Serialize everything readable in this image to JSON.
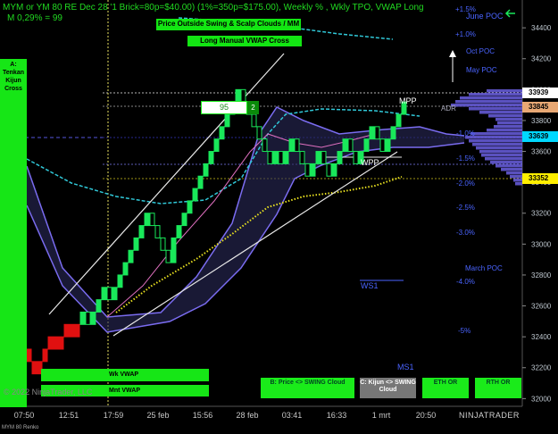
{
  "header": {
    "title": "MYM or YM 80 RE Dec 28 '1 Brick=80p=$40.00) (1%=350p=$175.00), Weekly % , Wkly TPO, VWAP Long",
    "subtitle": "M 0,29% = 99"
  },
  "banners": {
    "outside_swing": "Price Outside Swing & Scalp Clouds / MM ???",
    "long_vwap": "Long Manual VWAP Cross",
    "tenkan": "A: Tenkan Kijun Cross",
    "box_value": "95",
    "box_small": "2"
  },
  "buttons": {
    "wk_vwap": "Wk VWAP",
    "mnt_vwap": "Mnt VWAP",
    "price_swing": "B: Price <> SWING Cloud",
    "kijun_swing": "C: Kijun <> SWING Cloud",
    "eth_or": "ETH OR",
    "rth_or": "RTH OR"
  },
  "right_labels": {
    "june_poc": "June POC",
    "oct_poc": "Oct POC",
    "may_poc": "May POC",
    "march_poc": "March POC",
    "mpp": "MPP",
    "adr": "ADR",
    "wpp": "WPP",
    "ws1": "WS1",
    "ms1": "MS1"
  },
  "pct_labels": [
    "+1.5%",
    "+1.0%",
    "-1.0%",
    "-1.5%",
    "-2.0%",
    "-2.5%",
    "-3.0%",
    "-4.0%",
    "-5%"
  ],
  "price_tags": {
    "t1": "33939",
    "t2": "33845",
    "t3": "33639",
    "t4": "33352"
  },
  "colors": {
    "up_brick": "#19e85a",
    "down_brick": "#e01010",
    "cloud": "#6a5fe0",
    "accent_green": "#16e616"
  },
  "footer": {
    "copyright": "© 2022 NinjaTrader, LLC",
    "instrument": "MYM 80 Renko",
    "brand": "NINJATRADER"
  },
  "chart_data": {
    "type": "renko",
    "y_axis_ticks": [
      34400,
      34200,
      34000,
      33800,
      33600,
      33400,
      33200,
      33000,
      32800,
      32600,
      32400,
      32200,
      32000
    ],
    "x_axis_ticks": [
      "07:50",
      "12:51",
      "17:59",
      "25 feb",
      "15:56",
      "28 feb",
      "03:41",
      "16:33",
      "1 mrt",
      "20:50"
    ],
    "ylim": [
      31950,
      34580
    ],
    "brick_size": 80,
    "closes": [
      32400,
      32320,
      32240,
      32320,
      32240,
      32160,
      32240,
      32320,
      32400,
      32320,
      32400,
      32480,
      32400,
      32480,
      32560,
      32480,
      32560,
      32640,
      32720,
      32640,
      32720,
      32800,
      32880,
      32960,
      33040,
      33120,
      33200,
      33120,
      33040,
      32960,
      32880,
      33040,
      33120,
      33200,
      33280,
      33360,
      33440,
      33520,
      33600,
      33680,
      33760,
      33840,
      33920,
      34000,
      33920,
      33840,
      33760,
      33680,
      33600,
      33520,
      33600,
      33520,
      33600,
      33680,
      33600,
      33520,
      33440,
      33520,
      33600,
      33520,
      33440,
      33520,
      33600,
      33680,
      33600,
      33520,
      33600,
      33680,
      33760,
      33680,
      33600,
      33680,
      33760,
      33840,
      33920
    ]
  }
}
